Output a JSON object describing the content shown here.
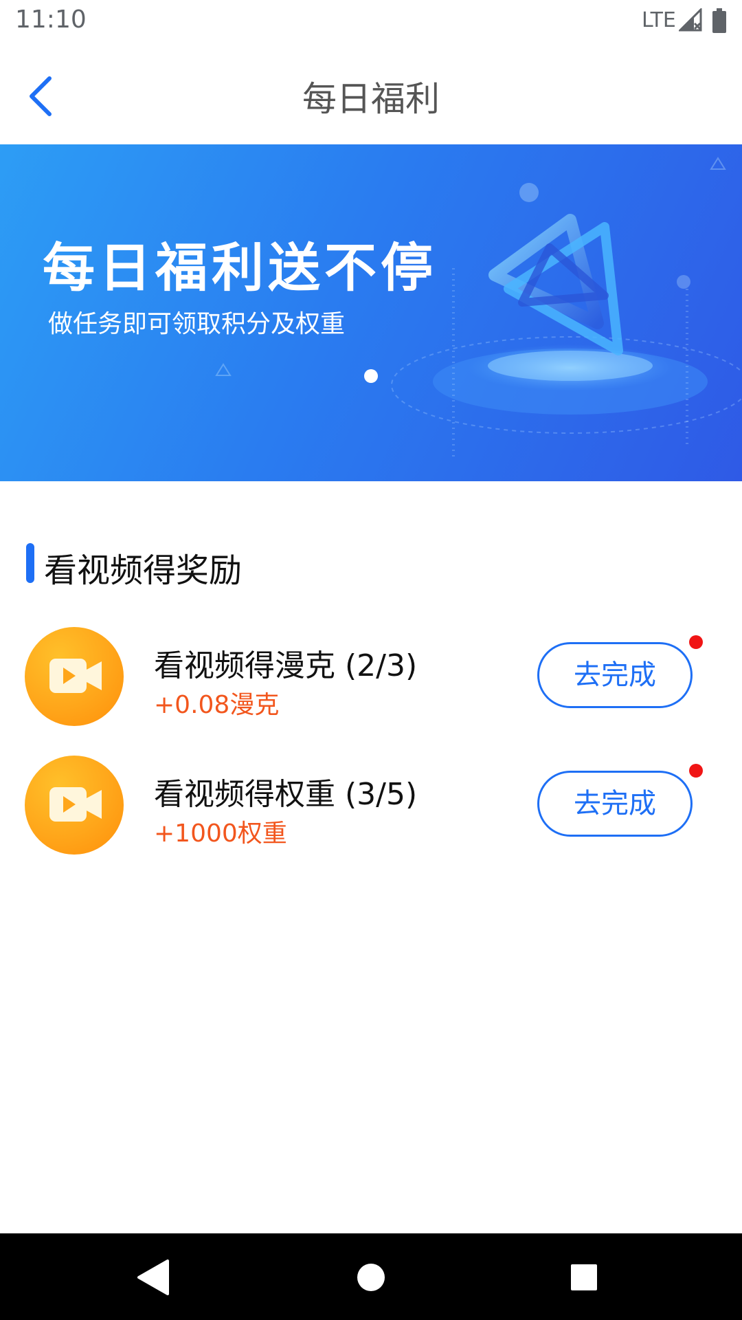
{
  "status_bar": {
    "time": "11:10",
    "network": "LTE",
    "icons": [
      "signal-icon",
      "battery-icon"
    ]
  },
  "header": {
    "title": "每日福利",
    "back_icon": "chevron-left-icon"
  },
  "banner": {
    "title": "每日福利送不停",
    "subtitle": "做任务即可领取积分及权重"
  },
  "section": {
    "title": "看视频得奖励"
  },
  "tasks": [
    {
      "name": "看视频得漫克 (2/3)",
      "reward": "+0.08漫克",
      "button": "去完成",
      "icon": "video-icon",
      "has_badge": true
    },
    {
      "name": "看视频得权重 (3/5)",
      "reward": "+1000权重",
      "button": "去完成",
      "icon": "video-icon",
      "has_badge": true
    }
  ],
  "nav_bar": {
    "icons": [
      "back-triangle-icon",
      "home-circle-icon",
      "recents-square-icon"
    ]
  },
  "colors": {
    "accent": "#1e6ff5",
    "reward": "#f2561d",
    "badge": "#f01515",
    "icon_bg": "#ffa61a"
  }
}
